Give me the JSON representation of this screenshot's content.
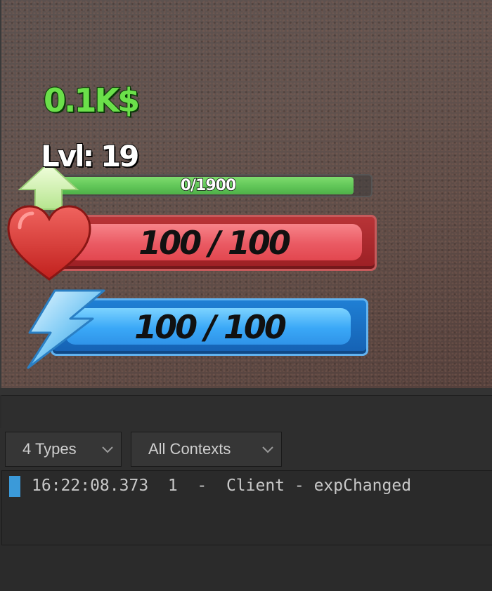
{
  "hud": {
    "cash": "0.1K$",
    "level": "Lvl: 19",
    "xp": {
      "text": "0/1900",
      "fill_fraction": 0.95
    },
    "health": {
      "text": "100 / 100",
      "current": 100,
      "max": 100
    },
    "energy": {
      "text": "100 / 100",
      "current": 100,
      "max": 100
    },
    "icons": {
      "level_up": "arrow-up-icon",
      "health": "heart-icon",
      "energy": "lightning-bolt-icon"
    },
    "colors": {
      "cash": "#6be04a",
      "xp": "#5ec356",
      "health": "#e2474f",
      "energy": "#3aa8f7"
    }
  },
  "output_panel": {
    "filters": {
      "types": "4 Types",
      "contexts": "All Contexts"
    },
    "log": [
      {
        "time": "16:22:08.373",
        "count": "1",
        "source": "Client",
        "message": "expChanged",
        "text": "16:22:08.373  1  -  Client - expChanged"
      }
    ],
    "log_marker_color": "#3b9ad9"
  }
}
